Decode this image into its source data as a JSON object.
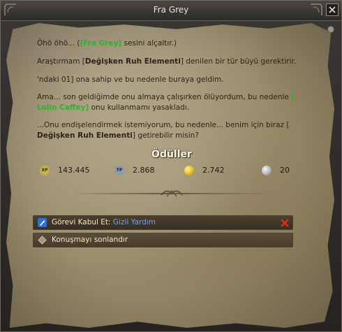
{
  "window": {
    "title": "Fra Grey"
  },
  "dialogue": {
    "p1_a": "Öhö öhö... (",
    "p1_name": "[Fra Grey]",
    "p1_b": " sesini alçaltır.)",
    "p2_a": "Araştırmam [",
    "p2_item": "Değişken Ruh Elementi",
    "p2_b": "] denilen bir tür büyü gerektirir.",
    "p3": "'ndaki 01] ona sahip ve bu nedenle buraya geldim.",
    "p4_a": "Ama... son geldiğimde onu almaya çalışırken ölüyordum, bu nedenle ",
    "p4_name": "[ Lolin Caffey]",
    "p4_b": " onu kullanmamı yasakladı.",
    "p5_a": "...Onu endişelendirmek istemiyorum, bu nedenle... benim için biraz [ ",
    "p5_item": "Değişken Ruh Elementi",
    "p5_b": "] getirebilir misin?"
  },
  "rewards": {
    "title": "Ödüller",
    "items": [
      {
        "icon": "xp-icon",
        "label": "XP",
        "value": "143.445",
        "color": "#c9b04a"
      },
      {
        "icon": "tp-icon",
        "label": "TP",
        "value": "2.868",
        "color": "#8f9aa6"
      },
      {
        "icon": "gold-coin-icon",
        "label": "",
        "value": "2.742",
        "color": "#e8c020"
      },
      {
        "icon": "silver-coin-icon",
        "label": "",
        "value": "20",
        "color": "#b7b7b7"
      }
    ]
  },
  "options": {
    "accept_prefix": "Görevi Kabul Et: ",
    "accept_quest": "Gizli Yardım",
    "end": "Konuşmayı sonlandır"
  }
}
